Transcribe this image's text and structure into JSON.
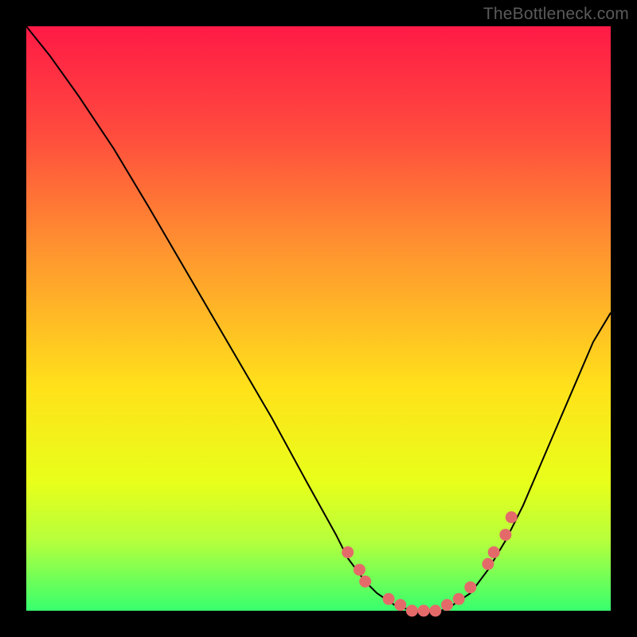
{
  "attribution": "TheBottleneck.com",
  "colors": {
    "background": "#000000",
    "gradient_top": "#ff1a46",
    "gradient_bottom": "#37ff6e",
    "curve": "#000000",
    "marker": "#e46a6a"
  },
  "chart_data": {
    "type": "line",
    "title": "",
    "xlabel": "",
    "ylabel": "",
    "xlim": [
      0,
      100
    ],
    "ylim": [
      0,
      100
    ],
    "grid": false,
    "legend": false,
    "series": [
      {
        "name": "curve",
        "x": [
          0,
          4,
          9,
          15,
          21,
          28,
          35,
          42,
          48,
          53,
          55,
          58,
          60,
          63,
          66,
          68,
          71,
          73,
          76,
          79,
          82,
          85,
          88,
          91,
          94,
          97,
          100
        ],
        "y": [
          100,
          95,
          88,
          79,
          69,
          57,
          45,
          33,
          22,
          13,
          9,
          5,
          3,
          1,
          0,
          0,
          0,
          1,
          3,
          7,
          12,
          18,
          25,
          32,
          39,
          46,
          51
        ]
      }
    ],
    "markers": {
      "name": "highlighted-points",
      "x": [
        55,
        57,
        58,
        62,
        64,
        66,
        68,
        70,
        72,
        74,
        76,
        79,
        80,
        82,
        83
      ],
      "y": [
        10,
        7,
        5,
        2,
        1,
        0,
        0,
        0,
        1,
        2,
        4,
        8,
        10,
        13,
        16
      ]
    }
  }
}
